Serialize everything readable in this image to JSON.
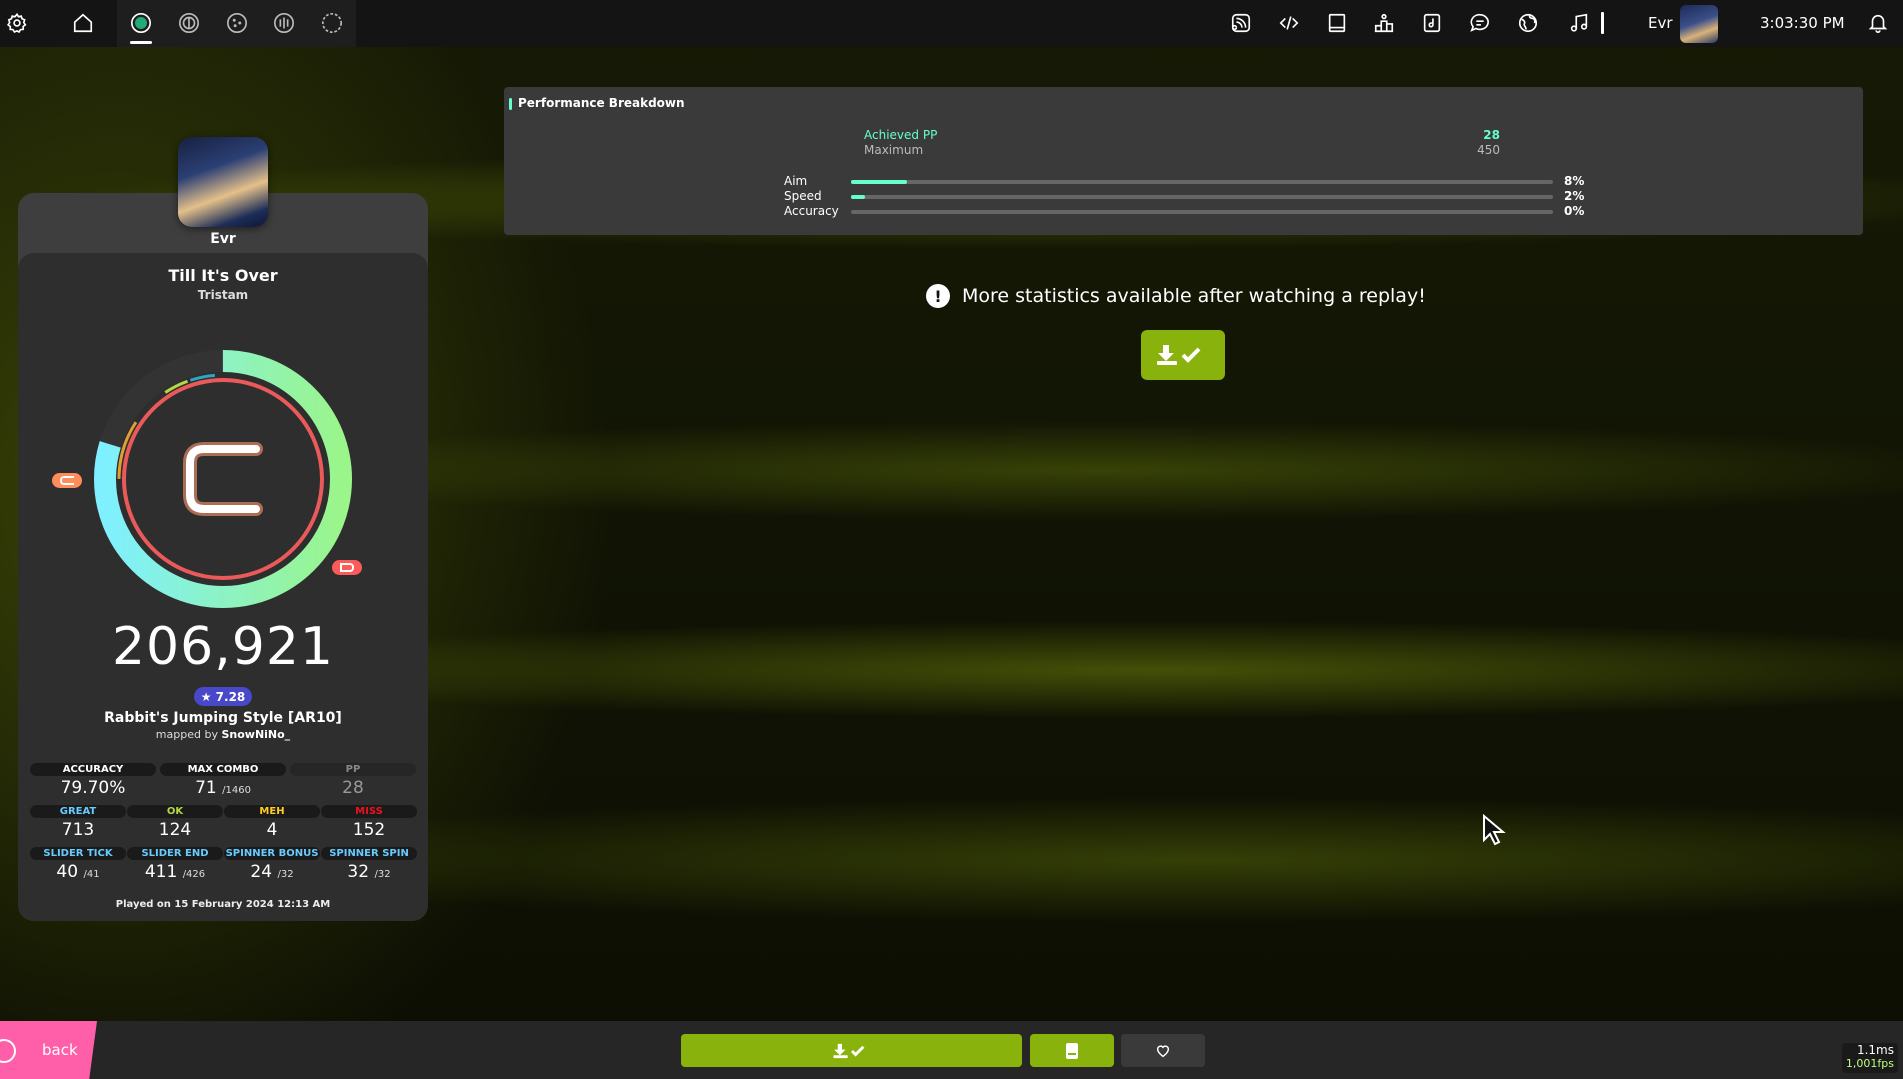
{
  "topbar": {
    "username": "Evr",
    "clock": "3:03:30 PM",
    "icons": [
      "settings-icon",
      "home-icon",
      "osu-ruleset-icon",
      "taiko-ruleset-icon",
      "catch-ruleset-icon",
      "mania-ruleset-icon",
      "circle-ruleset-icon",
      "news-icon",
      "code-icon",
      "wiki-icon",
      "rankings-icon",
      "beatmap-listing-icon",
      "chat-icon",
      "globe-icon",
      "music-icon",
      "notification-bell-icon"
    ]
  },
  "player": {
    "name": "Evr"
  },
  "beatmap": {
    "title": "Till It's Over",
    "artist": "Tristam",
    "difficulty": "Rabbit's Jumping Style [AR10]",
    "mapped_by_prefix": "mapped by",
    "mapper": "SnowNiNo_",
    "stars": "★ 7.28"
  },
  "result": {
    "rank": "C",
    "score": "206,921",
    "played_on": "Played on 15 February 2024 12:13 AM"
  },
  "stats": {
    "accuracy": {
      "label": "ACCURACY",
      "value": "79.70%"
    },
    "max_combo": {
      "label": "MAX COMBO",
      "value": "71",
      "max": "/1460"
    },
    "pp": {
      "label": "PP",
      "value": "28"
    },
    "great": {
      "label": "GREAT",
      "value": "713",
      "color": "#66ccff"
    },
    "ok": {
      "label": "OK",
      "value": "124",
      "color": "#b3d944"
    },
    "meh": {
      "label": "MEH",
      "value": "4",
      "color": "#ffcc22"
    },
    "miss": {
      "label": "MISS",
      "value": "152",
      "color": "#ed1121"
    },
    "slider_tick": {
      "label": "SLIDER TICK",
      "value": "40",
      "max": "/41"
    },
    "slider_end": {
      "label": "SLIDER END",
      "value": "411",
      "max": "/426"
    },
    "spinner_bonus": {
      "label": "SPINNER BONUS",
      "value": "24",
      "max": "/32"
    },
    "spinner_spin": {
      "label": "SPINNER SPIN",
      "value": "32",
      "max": "/32"
    }
  },
  "performance": {
    "title": "Performance Breakdown",
    "achieved_label": "Achieved PP",
    "achieved_value": "28",
    "maximum_label": "Maximum",
    "maximum_value": "450",
    "bars": [
      {
        "label": "Aim",
        "pct": "8%",
        "fraction": 0.08
      },
      {
        "label": "Speed",
        "pct": "2%",
        "fraction": 0.02
      },
      {
        "label": "Accuracy",
        "pct": "0%",
        "fraction": 0.0
      }
    ]
  },
  "notice": {
    "text": "More statistics available after watching a replay!"
  },
  "bottombar": {
    "back_label": "back",
    "fps_ms": "1.1ms",
    "fps_value": "1,001fps"
  },
  "colors": {
    "accent_green": "#8ab20c",
    "pp_teal": "#66ffcc",
    "back_pink": "#ff5fa8"
  }
}
